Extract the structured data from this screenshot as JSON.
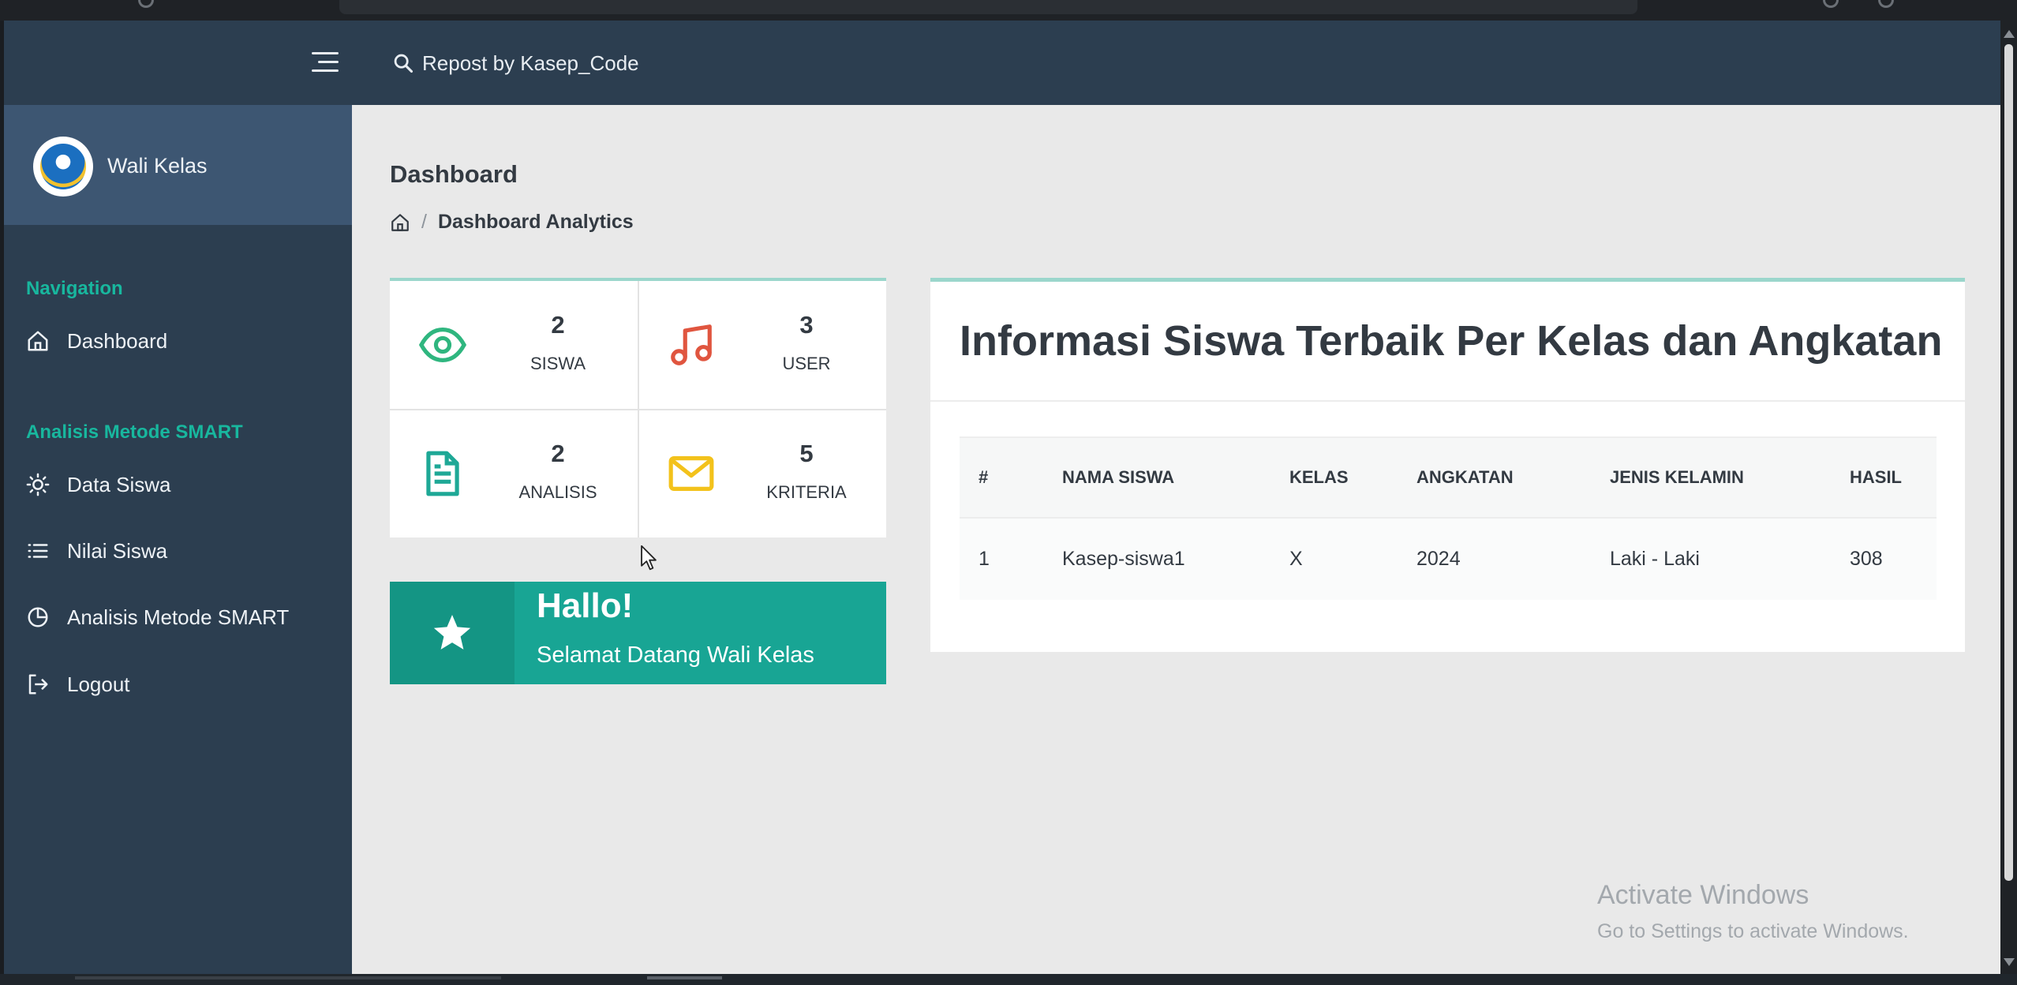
{
  "topbar": {
    "search_label": "Repost by Kasep_Code"
  },
  "sidebar": {
    "brand_title": "Wali Kelas",
    "sections": [
      {
        "caption": "Navigation",
        "items": [
          {
            "label": "Dashboard",
            "icon": "home-icon"
          }
        ]
      },
      {
        "caption": "Analisis Metode SMART",
        "items": [
          {
            "label": "Data Siswa",
            "icon": "sun-icon"
          },
          {
            "label": "Nilai Siswa",
            "icon": "list-icon"
          },
          {
            "label": "Analisis Metode SMART",
            "icon": "pie-chart-icon"
          },
          {
            "label": "Logout",
            "icon": "logout-icon"
          }
        ]
      }
    ]
  },
  "page": {
    "title": "Dashboard",
    "breadcrumb_current": "Dashboard Analytics",
    "breadcrumb_separator": "/"
  },
  "stats": [
    {
      "value": "2",
      "label": "SISWA",
      "icon": "eye-icon",
      "color": "#2fb67f"
    },
    {
      "value": "3",
      "label": "USER",
      "icon": "music-icon",
      "color": "#e0553f"
    },
    {
      "value": "2",
      "label": "ANALISIS",
      "icon": "file-text-icon",
      "color": "#1ea896"
    },
    {
      "value": "5",
      "label": "KRITERIA",
      "icon": "mail-icon",
      "color": "#f3c21b"
    }
  ],
  "hello": {
    "title": "Hallo!",
    "subtitle": "Selamat Datang Wali Kelas",
    "icon": "star-icon"
  },
  "info": {
    "title": "Informasi Siswa Terbaik Per Kelas dan Angkatan",
    "columns": [
      "#",
      "NAMA SISWA",
      "KELAS",
      "ANGKATAN",
      "JENIS KELAMIN",
      "HASIL"
    ],
    "rows": [
      [
        "1",
        "Kasep-siswa1",
        "X",
        "2024",
        "Laki - Laki",
        "308"
      ]
    ]
  },
  "watermark": {
    "title": "Activate Windows",
    "subtitle": "Go to Settings to activate Windows."
  },
  "colors": {
    "sidebar": "#2c3e50",
    "brand_bg": "#3d5672",
    "accent": "#18b79e",
    "hello_card": "#18a594",
    "card_top_border": "#9bd6cc"
  }
}
